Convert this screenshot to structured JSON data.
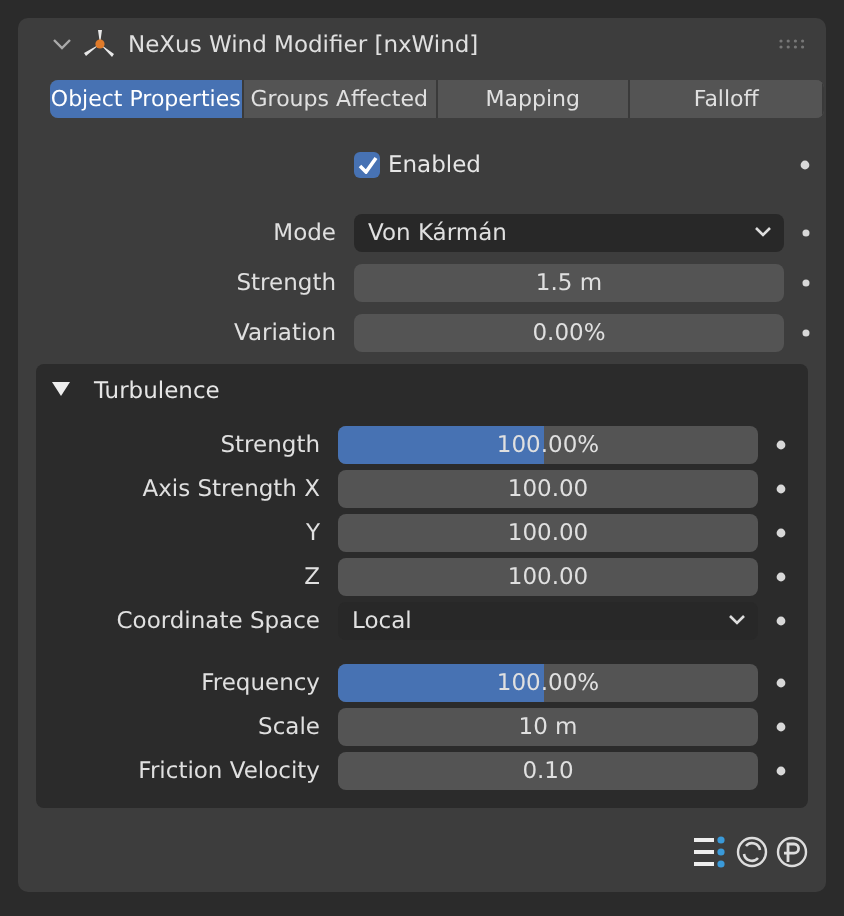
{
  "panel": {
    "title": "NeXus Wind Modifier [nxWind]",
    "expanded": true
  },
  "tabs": [
    {
      "label": "Object Properties",
      "selected": true
    },
    {
      "label": "Groups Affected",
      "selected": false
    },
    {
      "label": "Mapping",
      "selected": false
    },
    {
      "label": "Falloff",
      "selected": false
    }
  ],
  "enabled": {
    "label": "Enabled",
    "checked": true
  },
  "fields": [
    {
      "kind": "dropdown",
      "label": "Mode",
      "value": "Von Kármán"
    },
    {
      "kind": "number",
      "label": "Strength",
      "value": "1.5 m"
    },
    {
      "kind": "number",
      "label": "Variation",
      "value": "0.00%"
    }
  ],
  "turbulence": {
    "title": "Turbulence",
    "expanded": true,
    "sections": [
      {
        "rows": [
          {
            "kind": "slider",
            "label": "Strength",
            "value": "100.00%",
            "level": 0.49
          },
          {
            "kind": "number",
            "label": "Axis Strength X",
            "value": "100.00"
          },
          {
            "kind": "number",
            "label": "Y",
            "value": "100.00"
          },
          {
            "kind": "number",
            "label": "Z",
            "value": "100.00"
          },
          {
            "kind": "dropdown",
            "label": "Coordinate Space",
            "value": "Local"
          }
        ]
      },
      {
        "rows": [
          {
            "kind": "slider",
            "label": "Frequency",
            "value": "100.00%",
            "level": 0.49
          },
          {
            "kind": "number",
            "label": "Scale",
            "value": "10 m"
          },
          {
            "kind": "number",
            "label": "Friction Velocity",
            "value": "0.10"
          }
        ]
      }
    ]
  }
}
